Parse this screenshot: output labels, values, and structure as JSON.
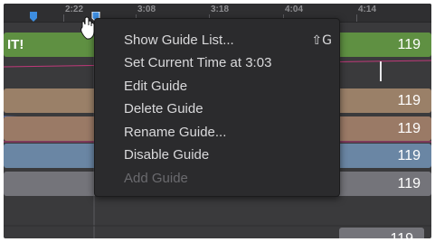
{
  "ruler": {
    "ticks": [
      "2:22",
      "3:08",
      "3:18",
      "4:04",
      "4:14"
    ]
  },
  "timeline": {
    "first_clip_label": "IT!",
    "clip_numbers": [
      "119",
      "119",
      "119",
      "119",
      "119",
      "119"
    ]
  },
  "context_menu": {
    "items": [
      {
        "label": "Show Guide List...",
        "shortcut": "⇧G",
        "enabled": true
      },
      {
        "label": "Set Current Time at 3:03",
        "enabled": true
      },
      {
        "label": "Edit Guide",
        "enabled": true
      },
      {
        "label": "Delete Guide",
        "enabled": true
      },
      {
        "label": "Rename Guide...",
        "enabled": true
      },
      {
        "label": "Disable Guide",
        "enabled": true
      },
      {
        "label": "Add Guide",
        "enabled": false
      }
    ]
  },
  "colors": {
    "green_clip": "#5f9042",
    "tan_clip": "#9a8068",
    "blue_clip": "#6a86a4",
    "gray_clip": "#74747a",
    "menu_bg": "#2b2b2d",
    "guide_blue": "#3d8de0"
  }
}
